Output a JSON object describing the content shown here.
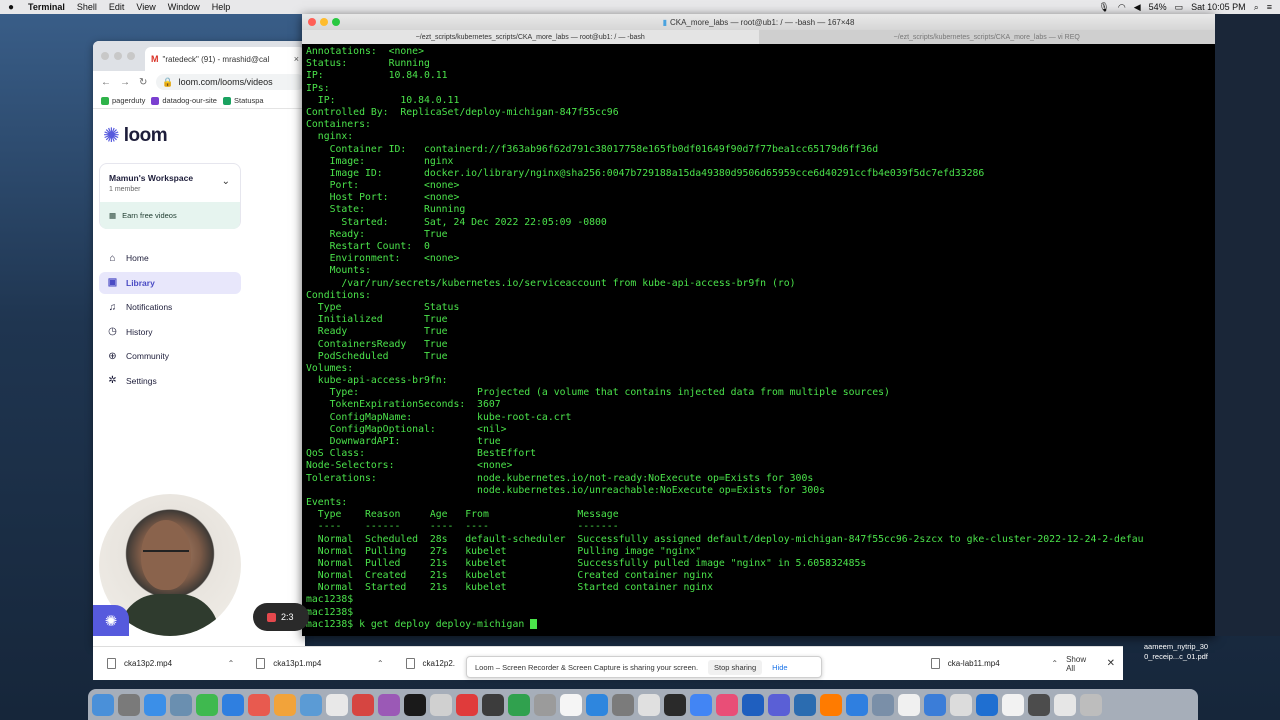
{
  "menubar": {
    "apple": "",
    "items": [
      "Terminal",
      "Shell",
      "Edit",
      "View",
      "Window",
      "Help"
    ],
    "battery": "54%",
    "clock": "Sat 10:05 PM"
  },
  "chrome": {
    "tab_title": "\"ratedeck\" (91) - mrashid@cal",
    "url": "loom.com/looms/videos",
    "bookmarks": [
      "pagerduty",
      "datadog-our-site",
      "Statuspa"
    ]
  },
  "loom": {
    "logo": "loom",
    "workspace_name": "Mamun's Workspace",
    "workspace_members": "1 member",
    "earn": "Earn free videos",
    "nav": [
      {
        "label": "Home",
        "icon": "home-icon"
      },
      {
        "label": "Library",
        "icon": "library-icon"
      },
      {
        "label": "Notifications",
        "icon": "bell-icon"
      },
      {
        "label": "History",
        "icon": "clock-icon"
      },
      {
        "label": "Community",
        "icon": "globe-icon"
      },
      {
        "label": "Settings",
        "icon": "gear-icon"
      }
    ]
  },
  "recording": {
    "timer": "2:3"
  },
  "terminal": {
    "title": "CKA_more_labs — root@ub1: / — -bash — 167×48",
    "tab_active": "~/ezt_scripts/kubernetes_scripts/CKA_more_labs — root@ub1: / — -bash",
    "tab_inactive": "~/ezt_scripts/kubernetes_scripts/CKA_more_labs — vi REQ",
    "lines": [
      "Annotations:  <none>",
      "Status:       Running",
      "IP:           10.84.0.11",
      "IPs:",
      "  IP:           10.84.0.11",
      "Controlled By:  ReplicaSet/deploy-michigan-847f55cc96",
      "Containers:",
      "  nginx:",
      "    Container ID:   containerd://f363ab96f62d791c38017758e165fb0df01649f90d7f77bea1cc65179d6ff36d",
      "    Image:          nginx",
      "    Image ID:       docker.io/library/nginx@sha256:0047b729188a15da49380d9506d65959cce6d40291ccfb4e039f5dc7efd33286",
      "    Port:           <none>",
      "    Host Port:      <none>",
      "    State:          Running",
      "      Started:      Sat, 24 Dec 2022 22:05:09 -0800",
      "    Ready:          True",
      "    Restart Count:  0",
      "    Environment:    <none>",
      "    Mounts:",
      "      /var/run/secrets/kubernetes.io/serviceaccount from kube-api-access-br9fn (ro)",
      "Conditions:",
      "  Type              Status",
      "  Initialized       True",
      "  Ready             True",
      "  ContainersReady   True",
      "  PodScheduled      True",
      "Volumes:",
      "  kube-api-access-br9fn:",
      "    Type:                    Projected (a volume that contains injected data from multiple sources)",
      "    TokenExpirationSeconds:  3607",
      "    ConfigMapName:           kube-root-ca.crt",
      "    ConfigMapOptional:       <nil>",
      "    DownwardAPI:             true",
      "QoS Class:                   BestEffort",
      "Node-Selectors:              <none>",
      "Tolerations:                 node.kubernetes.io/not-ready:NoExecute op=Exists for 300s",
      "                             node.kubernetes.io/unreachable:NoExecute op=Exists for 300s",
      "Events:",
      "  Type    Reason     Age   From               Message",
      "  ----    ------     ----  ----               -------",
      "  Normal  Scheduled  28s   default-scheduler  Successfully assigned default/deploy-michigan-847f55cc96-2szcx to gke-cluster-2022-12-24-2-defau",
      "  Normal  Pulling    27s   kubelet            Pulling image \"nginx\"",
      "  Normal  Pulled     21s   kubelet            Successfully pulled image \"nginx\" in 5.605832485s",
      "  Normal  Created    21s   kubelet            Created container nginx",
      "  Normal  Started    21s   kubelet            Started container nginx",
      "mac1238$",
      "mac1238$"
    ],
    "prompt_line": "mac1238$ k get deploy deploy-michigan "
  },
  "downloads": {
    "items": [
      "cka13p2.mp4",
      "cka13p1.mp4",
      "cka12p2.",
      "cka-lab11.mp4"
    ],
    "show_all": "Show All"
  },
  "loom_share": {
    "message": "Loom – Screen Recorder & Screen Capture is sharing your screen.",
    "stop": "Stop sharing",
    "hide": "Hide"
  },
  "desktop_file": "aameem_nytrip_30 0_receip...c_01.pdf",
  "dock_colors": [
    "#4a90d9",
    "#7a7a7a",
    "#3b8fe8",
    "#6a8fb0",
    "#3fb94f",
    "#2f7fe0",
    "#e85a4f",
    "#f2a33a",
    "#5b9bd5",
    "#e8e8e8",
    "#d64541",
    "#9b59b6",
    "#1a1a1a",
    "#d0d0d0",
    "#e03b3b",
    "#3c3c3c",
    "#30a14e",
    "#9b9b9b",
    "#f5f5f5",
    "#2e86de",
    "#7b7b7b",
    "#e0e0e0",
    "#2a2a2a",
    "#4285f4",
    "#e94e77",
    "#1f5fbf",
    "#5a5fd6",
    "#2b6cb0",
    "#ff7b00",
    "#2f7fe0",
    "#7a8fa8",
    "#f0f0f0",
    "#3b7dd8",
    "#dcdcdc",
    "#1f6fd1",
    "#f2f2f2",
    "#4c4c4c",
    "#e6e6e6",
    "#bdbdbd"
  ]
}
